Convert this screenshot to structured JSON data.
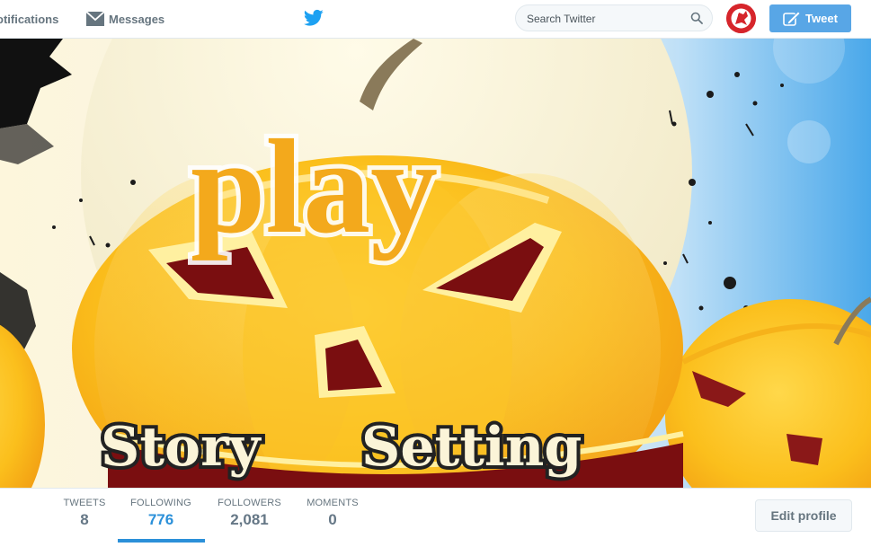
{
  "nav": {
    "notifications_label": "otifications",
    "messages_label": "Messages",
    "messages_icon": "envelope-icon",
    "logo_icon": "twitter-bird-icon",
    "search_placeholder": "Search Twitter",
    "search_icon": "magnifier-icon",
    "tweet_label": "Tweet",
    "tweet_icon": "compose-quill-icon",
    "brand_color": "#1da1f2"
  },
  "banner": {
    "title_text": "play",
    "buttons": [
      "Story",
      "Setting"
    ]
  },
  "profile_nav": {
    "stats": [
      {
        "label": "TWEETS",
        "value": "8"
      },
      {
        "label": "FOLLOWING",
        "value": "776"
      },
      {
        "label": "FOLLOWERS",
        "value": "2,081"
      },
      {
        "label": "MOMENTS",
        "value": "0"
      }
    ],
    "active_tab": "FOLLOWING",
    "edit_profile_label": "Edit profile"
  }
}
